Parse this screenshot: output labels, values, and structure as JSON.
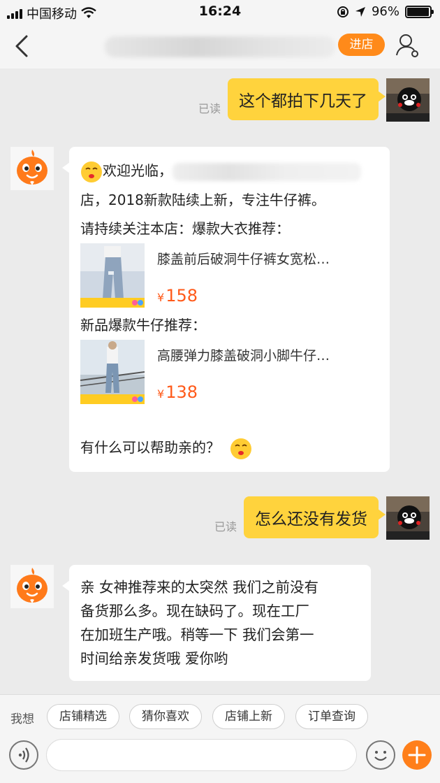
{
  "status_bar": {
    "carrier": "中国移动",
    "time": "16:24",
    "battery_percent": "96%",
    "battery_level": 0.96
  },
  "nav": {
    "enter_shop_label": "进店"
  },
  "messages": [
    {
      "from": "me",
      "text": "这个都拍下几天了",
      "status": "已读"
    },
    {
      "from": "shop",
      "greeting": "欢迎光临，",
      "line2": "店，2018新款陆续上新，专注牛仔裤。",
      "line3": "请持续关注本店：爆款大衣推荐：",
      "product1": {
        "title": "膝盖前后破洞牛仔裤女宽松…",
        "currency": "¥",
        "price": "158"
      },
      "section2": "新品爆款牛仔推荐：",
      "product2": {
        "title": "高腰弹力膝盖破洞小脚牛仔…",
        "currency": "¥",
        "price": "138"
      },
      "closing": "有什么可以帮助亲的？"
    },
    {
      "from": "me",
      "text": "怎么还没有发货",
      "status": "已读"
    },
    {
      "from": "shop",
      "lines": [
        "亲 女神推荐来的太突然 我们之前没有",
        "备货那么多。现在缺码了。现在工厂",
        "在加班生产哦。稍等一下 我们会第一",
        "时间给亲发货哦 爱你哟"
      ]
    }
  ],
  "quick_bar": {
    "label": "我想",
    "chips": [
      "店铺精选",
      "猜你喜欢",
      "店铺上新",
      "订单查询"
    ]
  },
  "colors": {
    "accent": "#ff8a1a",
    "my_bubble": "#ffd33d",
    "price": "#ff5a1a",
    "background": "#ebebeb"
  }
}
